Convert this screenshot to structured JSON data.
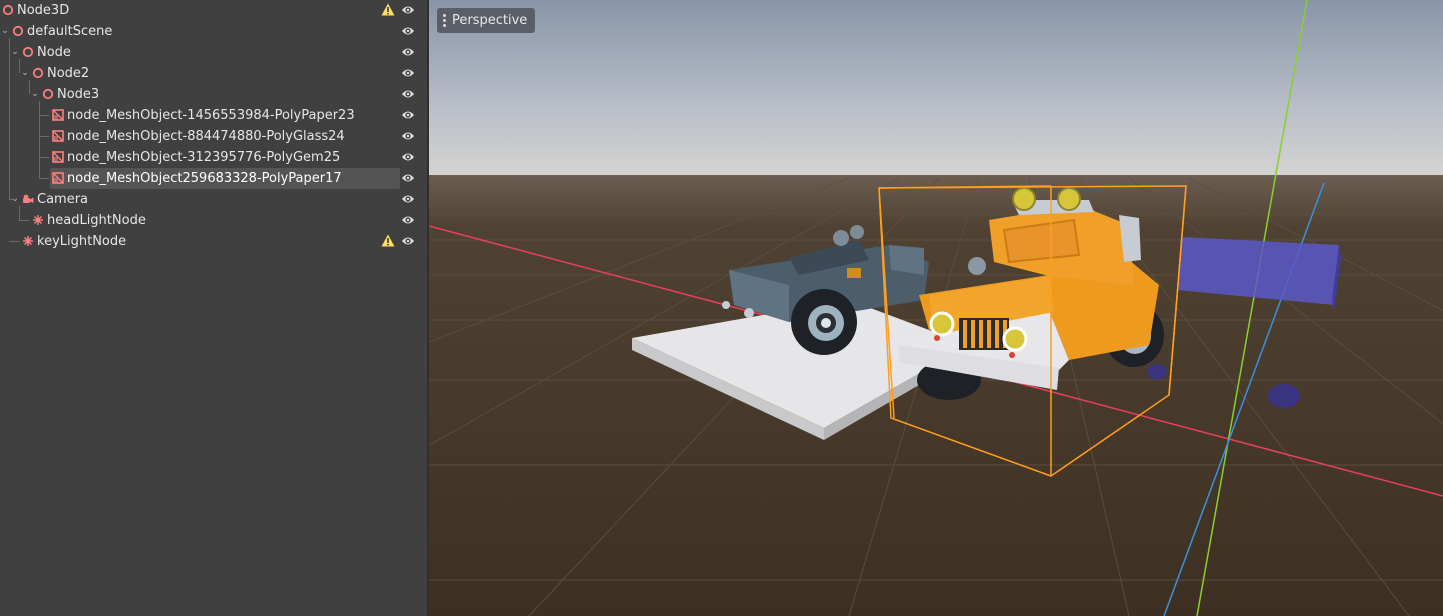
{
  "tree": {
    "nodes": [
      {
        "label": "Node3D",
        "icon": "node3d-icon",
        "expanded": null,
        "warning": true
      },
      {
        "label": "defaultScene",
        "icon": "node3d-icon",
        "expanded": true,
        "warning": false
      },
      {
        "label": "Node",
        "icon": "node3d-icon",
        "expanded": true,
        "warning": false
      },
      {
        "label": "Node2",
        "icon": "node3d-icon",
        "expanded": true,
        "warning": false
      },
      {
        "label": "Node3",
        "icon": "node3d-icon",
        "expanded": true,
        "warning": false
      },
      {
        "label": "node_MeshObject-1456553984-PolyPaper23",
        "icon": "mesh-instance-icon",
        "expanded": null,
        "warning": false
      },
      {
        "label": "node_MeshObject-884474880-PolyGlass24",
        "icon": "mesh-instance-icon",
        "expanded": null,
        "warning": false
      },
      {
        "label": "node_MeshObject-312395776-PolyGem25",
        "icon": "mesh-instance-icon",
        "expanded": null,
        "warning": false
      },
      {
        "label": "node_MeshObject259683328-PolyPaper17",
        "icon": "mesh-instance-icon",
        "expanded": null,
        "warning": false,
        "selected": true
      },
      {
        "label": "Camera",
        "icon": "camera-icon",
        "expanded": true,
        "warning": false
      },
      {
        "label": "headLightNode",
        "icon": "light-icon",
        "expanded": null,
        "warning": false
      },
      {
        "label": "keyLightNode",
        "icon": "light-icon",
        "expanded": null,
        "warning": true
      }
    ]
  },
  "viewport": {
    "view_mode_label": "Perspective"
  },
  "colors": {
    "panel_bg": "#404040",
    "selection": "#545454",
    "node_red": "#fc7f7f",
    "warning_yellow": "#ffdd65",
    "x_axis": "#e8405a",
    "y_axis": "#8ad02c",
    "z_axis": "#3d8fe0",
    "selection_box": "#ff9e1f"
  }
}
